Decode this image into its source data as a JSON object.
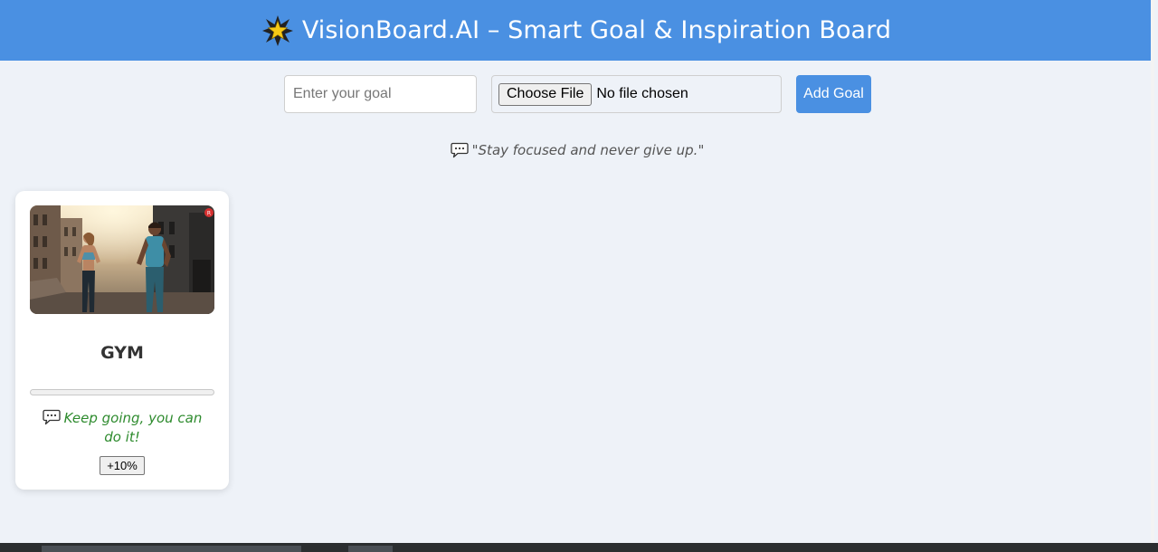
{
  "header": {
    "title": "VisionBoard.AI – Smart Goal & Inspiration Board",
    "icon": "star-icon",
    "background": "#4a90e2"
  },
  "form": {
    "goal_placeholder": "Enter your goal",
    "goal_value": "",
    "file_button_label": "Choose File",
    "file_status": "No file chosen",
    "add_button_label": "Add Goal"
  },
  "quote": {
    "icon": "speech-bubble-icon",
    "text": "\"Stay focused and never give up.\""
  },
  "goals": [
    {
      "title": "GYM",
      "image_icon": "gym-photo",
      "progress": 0,
      "message": "Keep going, you can do it!",
      "message_icon": "speech-bubble-icon",
      "increment_label": "+10%"
    }
  ],
  "colors": {
    "accent": "#4a90e2",
    "page_background": "#eef2f8",
    "message_text": "#2e8b2e"
  }
}
